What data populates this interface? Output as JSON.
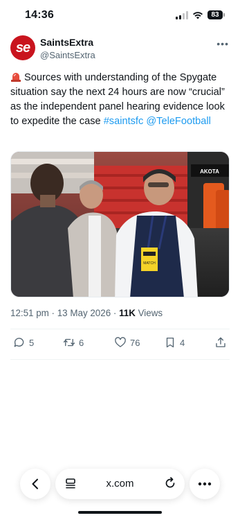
{
  "status_bar": {
    "time": "14:36",
    "battery": "83"
  },
  "tweet": {
    "author_name": "SaintsExtra",
    "author_handle": "@SaintsExtra",
    "avatar_text": "se",
    "text_main": "Sources with understanding of the Spygate situation say the next 24 hours are now “crucial” as the independent panel hearing evidence look to expedite the case",
    "hashtag": "#saintsfc",
    "mention": "@TeleFootball",
    "meta_time": "12:51 pm · 13 May 2026 · ",
    "views_count": "11K",
    "views_label": " Views",
    "image_sign_text": "AKOTA",
    "image_lanyard_text": "MATCH"
  },
  "actions": {
    "replies": "5",
    "retweets": "6",
    "likes": "76",
    "bookmarks": "4"
  },
  "browser": {
    "url": "x.com"
  },
  "colors": {
    "link": "#1d9bf0",
    "avatar_bg": "#c9141e",
    "secondary_text": "#536471"
  }
}
